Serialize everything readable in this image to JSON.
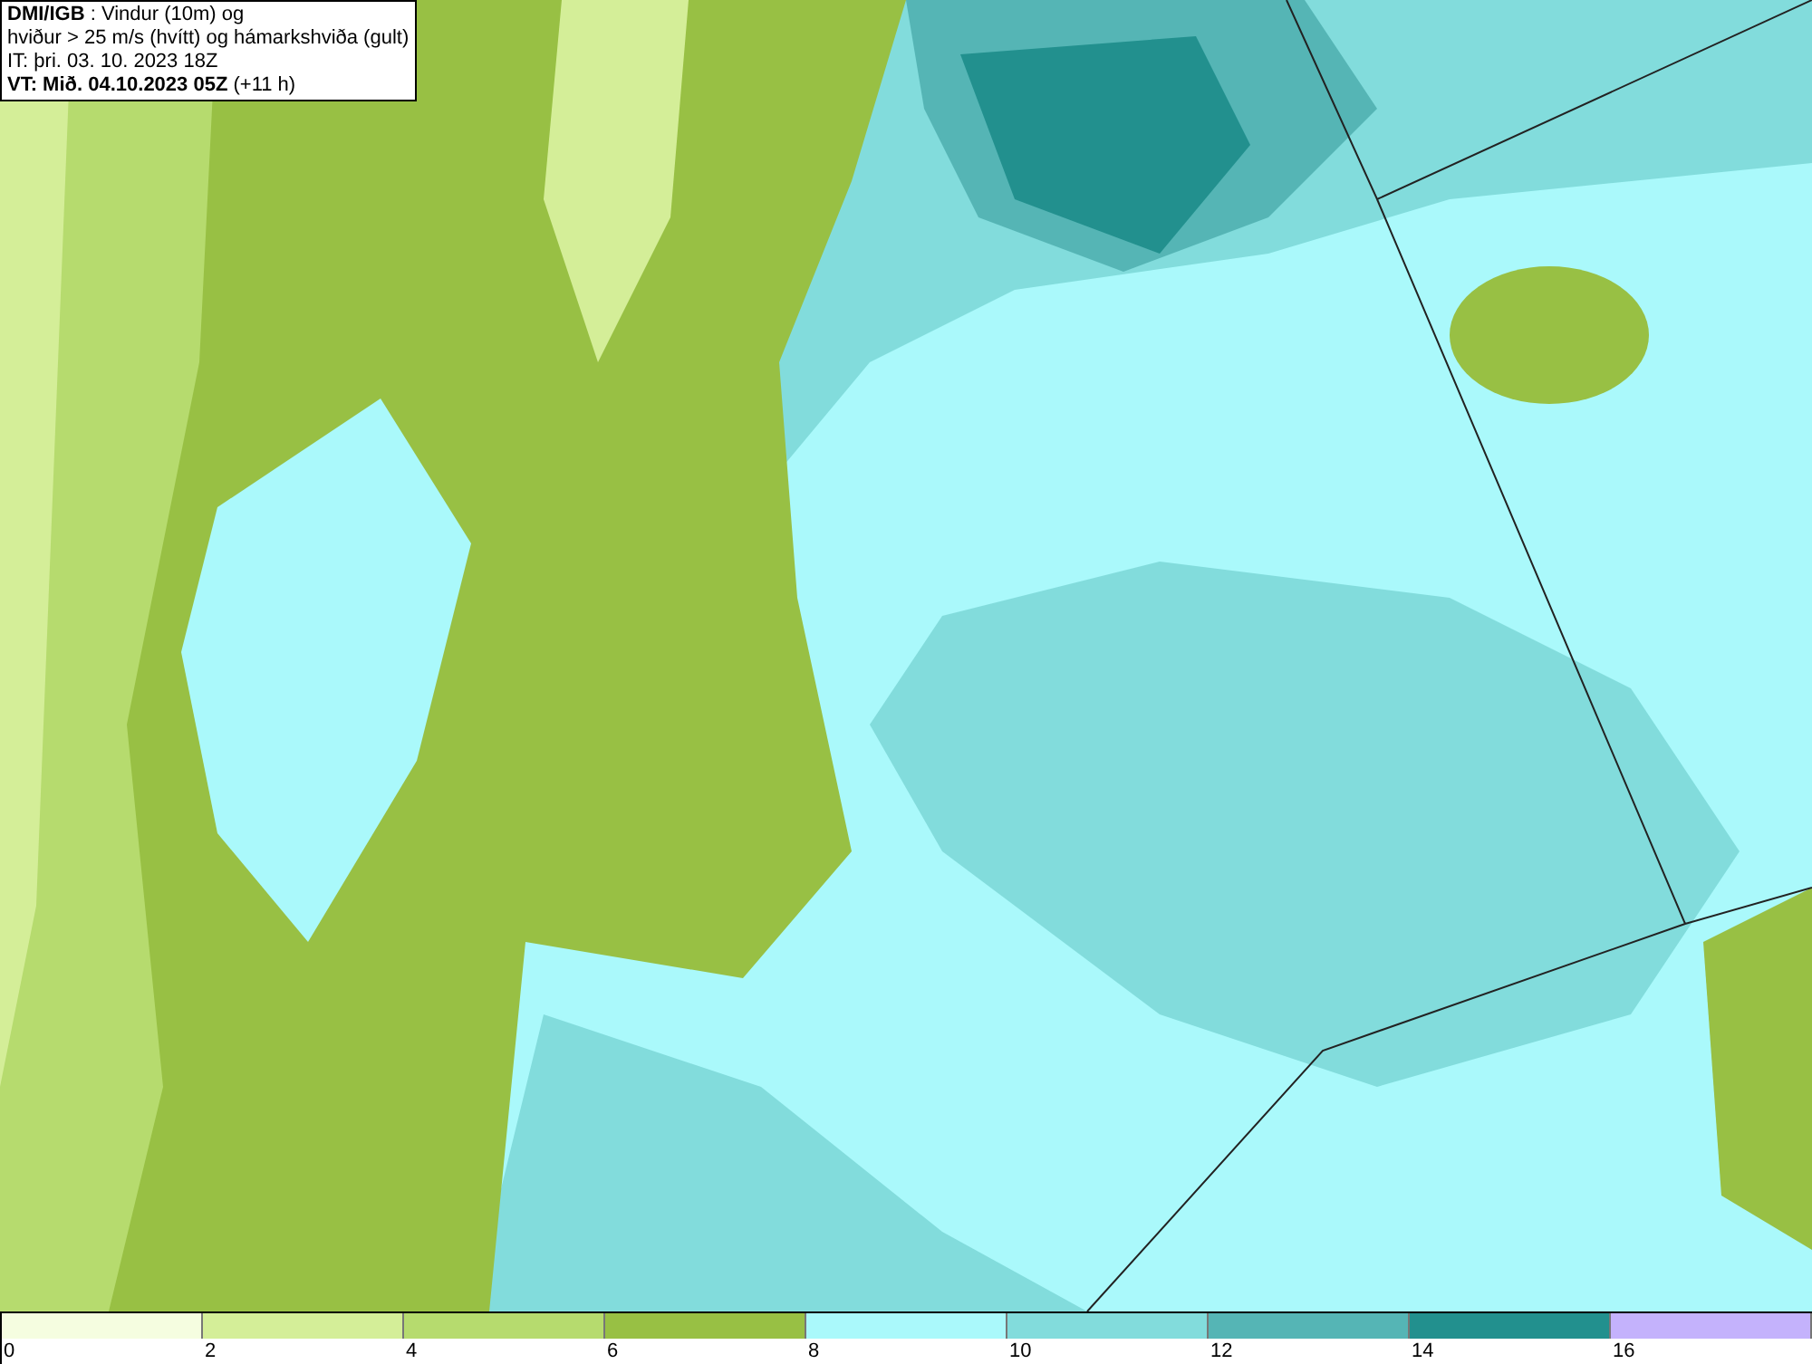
{
  "header": {
    "lines": [
      "**DMI/IGB** : Vindur (10m) og",
      "hviður > 25 m/s (hvítt) og hámarkshviða (gult)",
      "IT: þri. 03. 10. 2023 18Z",
      "**VT: Mið. 04.10.2023 05Z** (+11 h)"
    ]
  },
  "legend": {
    "segments": [
      {
        "color": "#f5fde0",
        "label": "0"
      },
      {
        "color": "#d4ee98",
        "label": "2"
      },
      {
        "color": "#b6db6e",
        "label": "4"
      },
      {
        "color": "#98c044",
        "label": "6"
      },
      {
        "color": "#aaf9fb",
        "label": "8"
      },
      {
        "color": "#82dcdc",
        "label": "10"
      },
      {
        "color": "#55b5b5",
        "label": "12"
      },
      {
        "color": "#22908e",
        "label": "14"
      },
      {
        "color": "#c4b2fc",
        "label": "16"
      }
    ]
  }
}
